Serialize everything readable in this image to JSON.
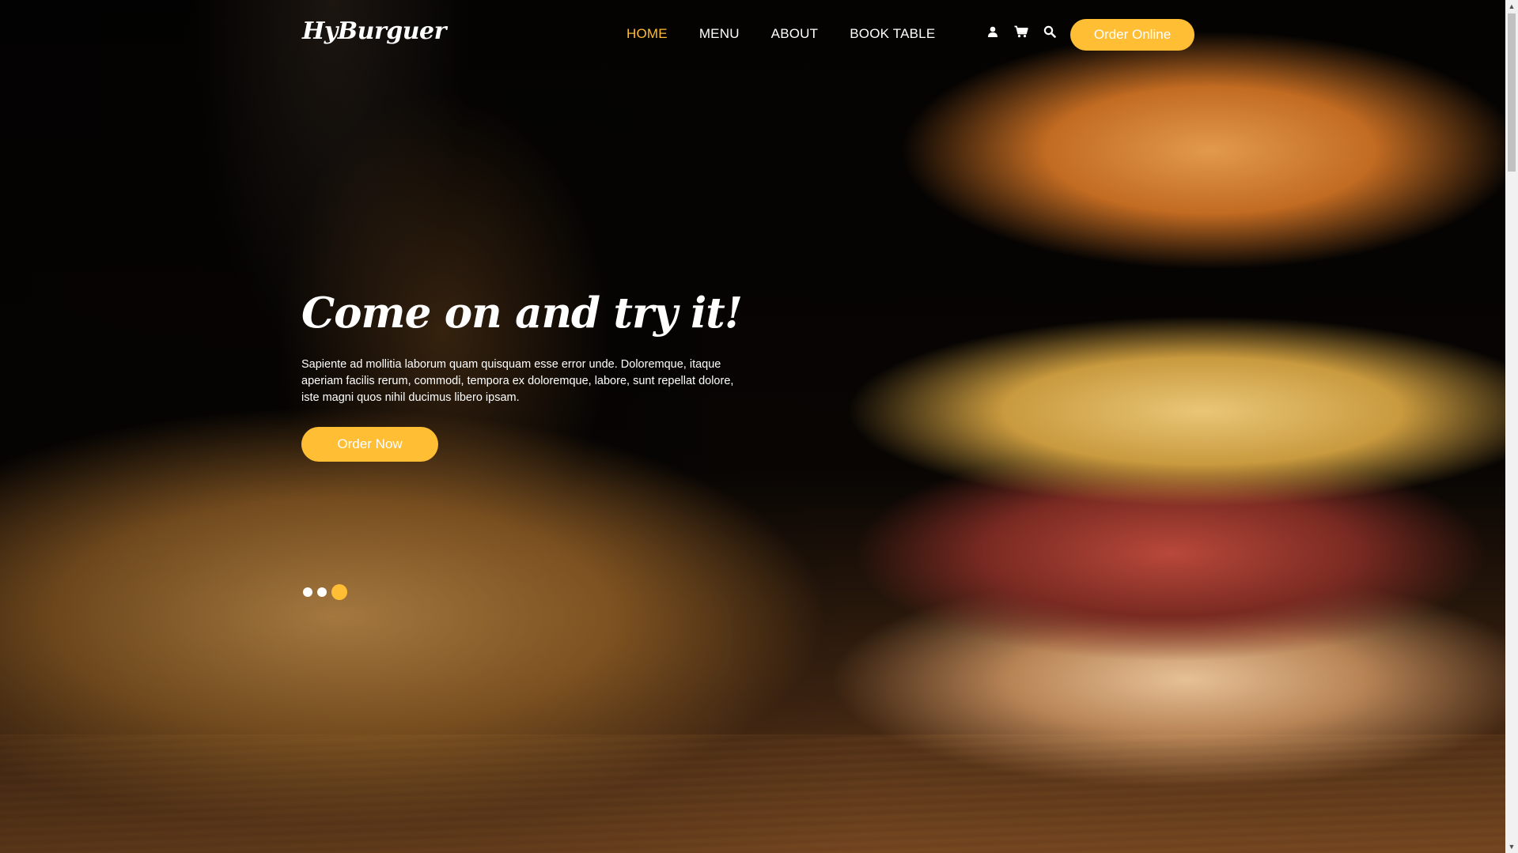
{
  "header": {
    "brand": "HyBurguer",
    "nav": [
      "HOME",
      "MENU",
      "ABOUT",
      "BOOK TABLE"
    ],
    "active_nav": "HOME",
    "order_online_label": "Order Online",
    "icons": [
      "user-icon",
      "cart-icon",
      "search-icon"
    ]
  },
  "hero": {
    "title": "Come on and try it!",
    "description": "Sapiente ad mollitia laborum quam quisquam esse error unde. Doloremque, itaque aperiam facilis rerum, commodi, tempora ex doloremque, labore, sunt repellat dolore, iste magni quos nihil ducimus libero ipsam.",
    "order_now_label": "Order Now",
    "carousel": {
      "slides": 3,
      "active_slide": 3
    }
  },
  "colors": {
    "accent": "#ffbe33",
    "text": "#ffffff",
    "background": "#000000"
  }
}
